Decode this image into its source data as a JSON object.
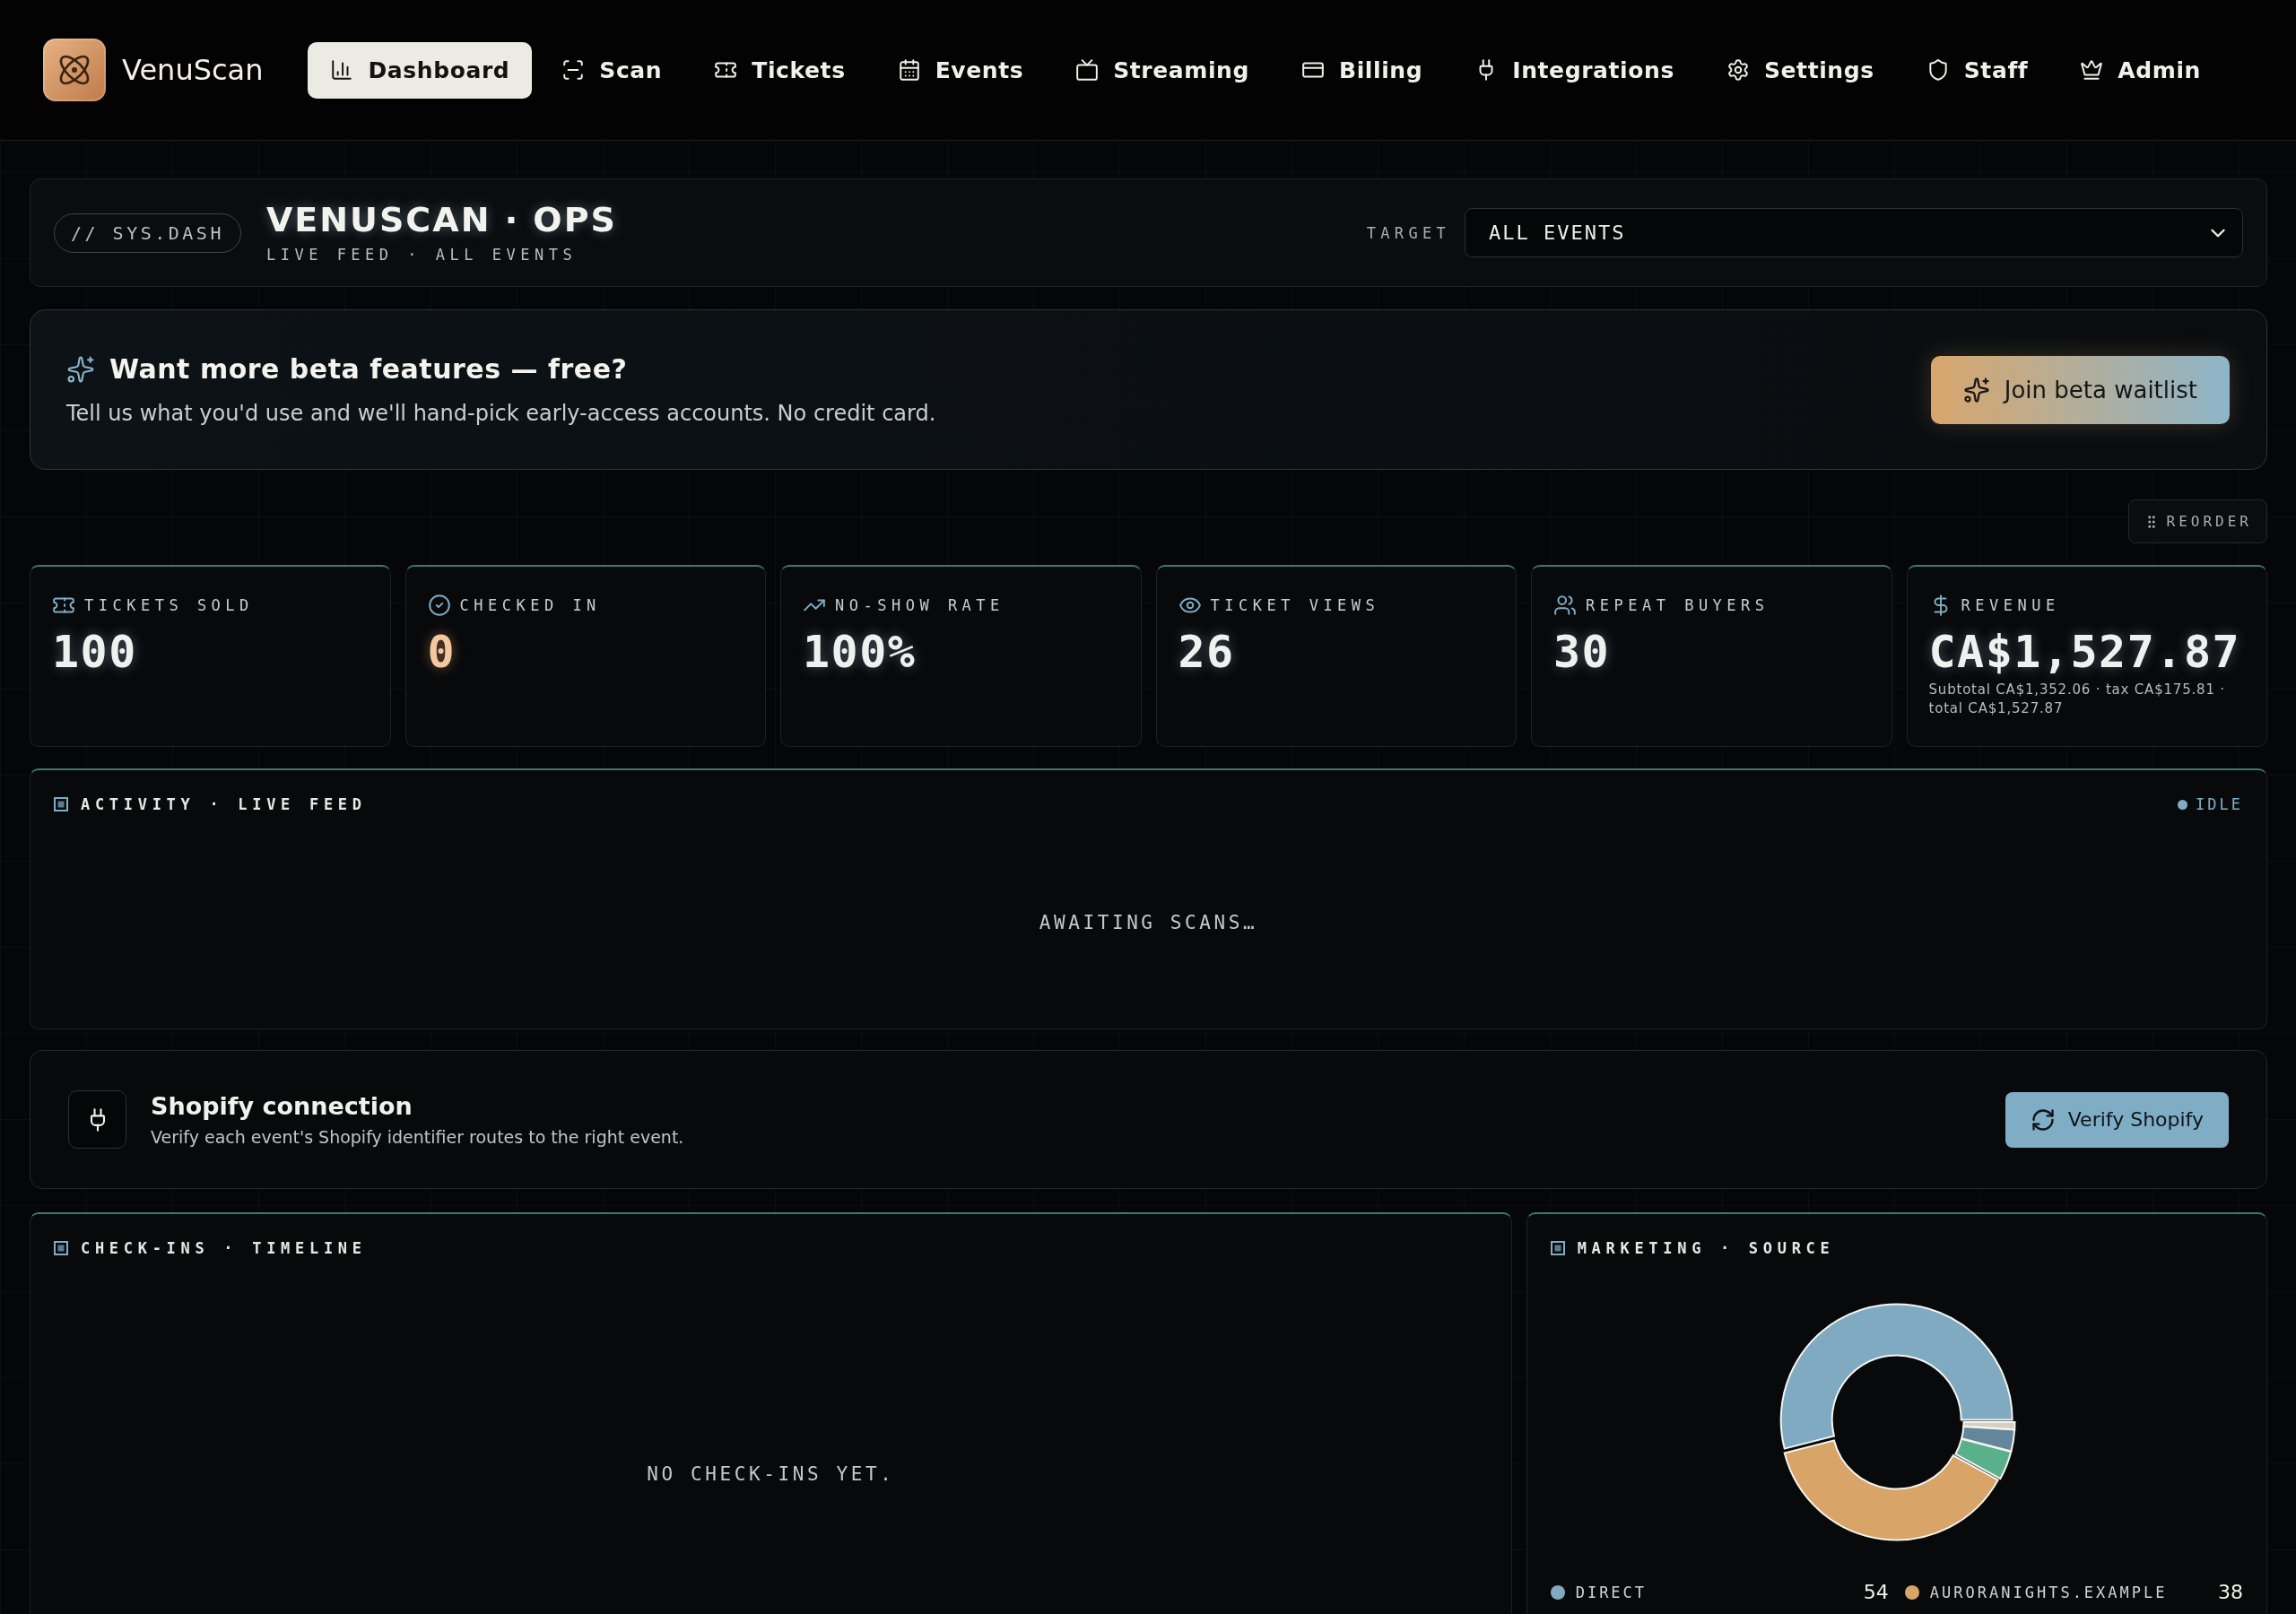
{
  "nav": {
    "brand": "VenuScan",
    "items": [
      {
        "label": "Dashboard",
        "selected": true
      },
      {
        "label": "Scan",
        "selected": false
      },
      {
        "label": "Tickets",
        "selected": false
      },
      {
        "label": "Events",
        "selected": false
      },
      {
        "label": "Streaming",
        "selected": false
      },
      {
        "label": "Billing",
        "selected": false
      },
      {
        "label": "Integrations",
        "selected": false
      },
      {
        "label": "Settings",
        "selected": false
      },
      {
        "label": "Staff",
        "selected": false
      },
      {
        "label": "Admin",
        "selected": false
      }
    ]
  },
  "header": {
    "tag": "// SYS.DASH",
    "title": "VENUSCAN · OPS",
    "subtitle": "LIVE FEED · ALL EVENTS",
    "target_label": "TARGET",
    "target_value": "ALL EVENTS"
  },
  "beta_banner": {
    "title": "Want more beta features — free?",
    "text": "Tell us what you'd use and we'll hand-pick early-access accounts. No credit card.",
    "button": "Join beta waitlist"
  },
  "reorder_button": "REORDER",
  "stats": [
    {
      "label": "TICKETS SOLD",
      "value": "100",
      "warning": false
    },
    {
      "label": "CHECKED IN",
      "value": "0",
      "warning": true
    },
    {
      "label": "NO-SHOW RATE",
      "value": "100%",
      "warning": false
    },
    {
      "label": "TICKET VIEWS",
      "value": "26",
      "warning": false
    },
    {
      "label": "REPEAT BUYERS",
      "value": "30",
      "warning": false
    },
    {
      "label": "REVENUE",
      "value": "CA$1,527.87",
      "warning": false,
      "note": "Subtotal CA$1,352.06 · tax CA$175.81 · total CA$1,527.87"
    }
  ],
  "activity": {
    "title": "ACTIVITY · LIVE FEED",
    "status": "IDLE",
    "empty_text": "AWAITING SCANS…"
  },
  "shopify": {
    "title": "Shopify connection",
    "text": "Verify each event's Shopify identifier routes to the right event.",
    "button": "Verify Shopify"
  },
  "checkins": {
    "title": "CHECK-INS · TIMELINE",
    "empty_text": "NO CHECK-INS YET."
  },
  "marketing": {
    "title": "MARKETING · SOURCE",
    "chart_data": {
      "type": "donut",
      "values": [
        54,
        38,
        4,
        3,
        1
      ],
      "colors": [
        "#7faac2",
        "#d8a468",
        "#5bb08c",
        "#63869b",
        "#d6d0c2"
      ]
    },
    "legend": [
      {
        "label": "DIRECT",
        "value": "54",
        "color": "#7faac2"
      },
      {
        "label": "AURORANIGHTS.EXAMPLE",
        "value": "38",
        "color": "#d8a468"
      }
    ]
  }
}
